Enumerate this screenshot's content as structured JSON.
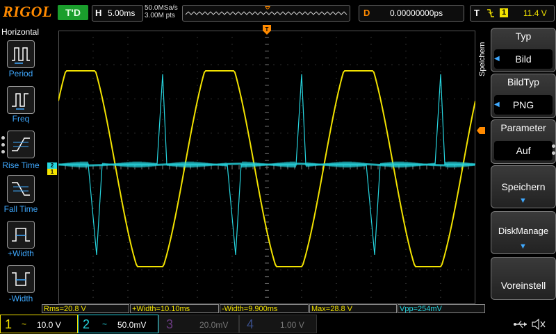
{
  "brand": "RIGOL",
  "status": "T'D",
  "horizontal": {
    "label": "H",
    "value": "5.00ms"
  },
  "sample": {
    "rate": "50.0MSa/s",
    "points": "3.00M pts"
  },
  "delay": {
    "label": "D",
    "value": "0.00000000ps"
  },
  "trigger": {
    "label": "T",
    "source": "1",
    "level": "11.4 V"
  },
  "left_menu": {
    "title": "Horizontal",
    "items": [
      {
        "label": "Period"
      },
      {
        "label": "Freq"
      },
      {
        "label": "Rise Time"
      },
      {
        "label": "Fall Time"
      },
      {
        "label": "+Width"
      },
      {
        "label": "-Width"
      }
    ]
  },
  "right_menu": {
    "side_label": "Speichern",
    "typ": {
      "header": "Typ",
      "value": "Bild"
    },
    "bildtyp": {
      "header": "BildTyp",
      "value": "PNG"
    },
    "parameter": {
      "header": "Parameter",
      "value": "Auf"
    },
    "speichern": "Speichern",
    "diskmanage": "DiskManage",
    "voreinstell": "Voreinstell"
  },
  "measurements": [
    "Rms=20.8 V",
    "+Width=10.10ms",
    "-Width=9.900ms",
    "Max=28.8 V",
    "Vpp=254mV"
  ],
  "channels": [
    {
      "num": "1",
      "coupling": "~",
      "scale": "10.0 V",
      "color": "#f2e200",
      "active": true
    },
    {
      "num": "2",
      "coupling": "~",
      "scale": "50.0mV",
      "color": "#27d6e0",
      "active": true
    },
    {
      "num": "3",
      "coupling": "",
      "scale": "20.0mV",
      "color": "#a050c0",
      "active": false
    },
    {
      "num": "4",
      "coupling": "",
      "scale": "1.00 V",
      "color": "#4a70d0",
      "active": false
    }
  ],
  "markers": {
    "ch1": "1",
    "ch2": "2",
    "trigger_pos": "T"
  },
  "colors": {
    "ch1": "#f2e200",
    "ch2": "#27d6e0",
    "accent": "#ff8a00",
    "menu_accent": "#3fa9ff"
  }
}
